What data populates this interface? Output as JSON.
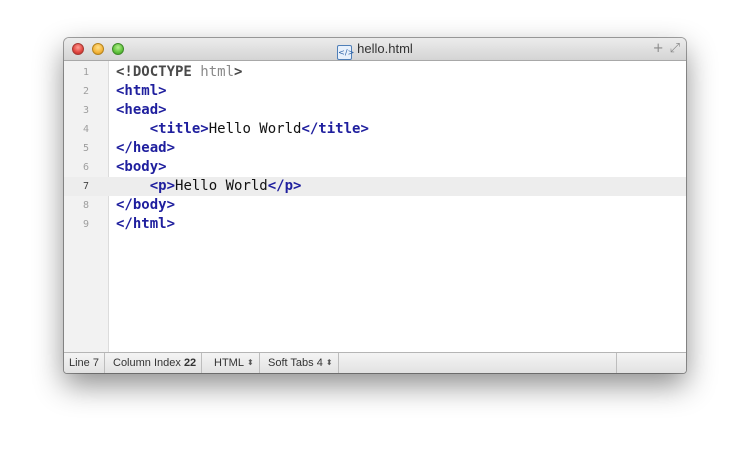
{
  "window": {
    "title": "hello.html",
    "title_icon": "html-file-icon",
    "actions": {
      "add": "+",
      "fullscreen": "⤢"
    }
  },
  "editor": {
    "current_line": 7,
    "lines": [
      {
        "number": "1",
        "tokens": [
          {
            "t": "<!DOCTYPE ",
            "c": "doctype"
          },
          {
            "t": "html",
            "c": "doctype-attr"
          },
          {
            "t": ">",
            "c": "doctype"
          }
        ]
      },
      {
        "number": "2",
        "tokens": [
          {
            "t": "<html>",
            "c": "tag"
          }
        ]
      },
      {
        "number": "3",
        "tokens": [
          {
            "t": "<head>",
            "c": "tag"
          }
        ]
      },
      {
        "number": "4",
        "tokens": [
          {
            "t": "    ",
            "c": ""
          },
          {
            "t": "<title>",
            "c": "tag"
          },
          {
            "t": "Hello World",
            "c": ""
          },
          {
            "t": "</title>",
            "c": "tag"
          }
        ]
      },
      {
        "number": "5",
        "tokens": [
          {
            "t": "</head>",
            "c": "tag"
          }
        ]
      },
      {
        "number": "6",
        "tokens": [
          {
            "t": "<body>",
            "c": "tag"
          }
        ]
      },
      {
        "number": "7",
        "tokens": [
          {
            "t": "    ",
            "c": ""
          },
          {
            "t": "<p>",
            "c": "tag"
          },
          {
            "t": "Hello World",
            "c": ""
          },
          {
            "t": "</p>",
            "c": "tag"
          }
        ]
      },
      {
        "number": "8",
        "tokens": [
          {
            "t": "</body>",
            "c": "tag"
          }
        ]
      },
      {
        "number": "9",
        "tokens": [
          {
            "t": "</html>",
            "c": "tag"
          }
        ]
      }
    ]
  },
  "status": {
    "line_label": "Line",
    "line_value": "7",
    "column_label": "Column Index",
    "column_value": "22",
    "syntax": "HTML",
    "tabs": "Soft Tabs 4",
    "stepper_glyph": "⬍"
  },
  "colors": {
    "tag": "#1f1f9e",
    "current_line": "#ededed",
    "gutter": "#f2f2f2"
  }
}
